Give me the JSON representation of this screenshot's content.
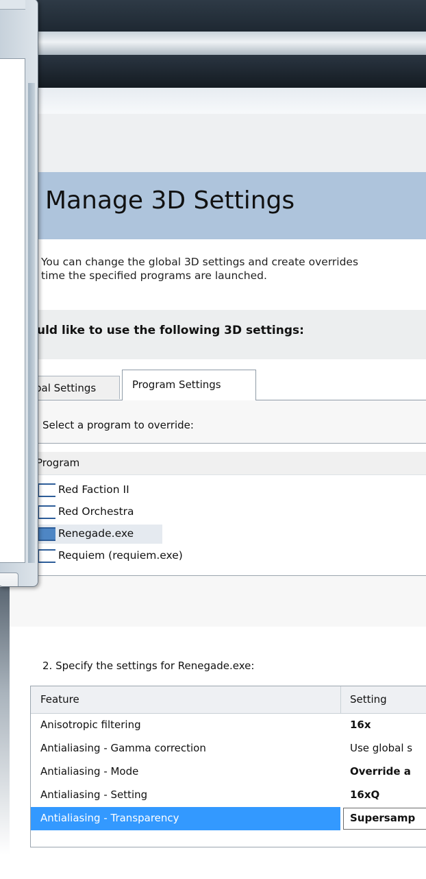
{
  "header": {
    "title": "Manage 3D Settings",
    "description_line1": "You can change the global 3D settings and create overrides",
    "description_line2": "time the specified programs are launched.",
    "subheader": "uld like to use the following 3D settings:"
  },
  "tabs": [
    {
      "label": "bal Settings",
      "active": false
    },
    {
      "label": "Program Settings",
      "active": true
    }
  ],
  "program_section": {
    "step_label": "Select a program to override:",
    "column_header": "Program",
    "programs": [
      {
        "label": "Red Faction II",
        "selected": false
      },
      {
        "label": "Red Orchestra",
        "selected": false
      },
      {
        "label": "Renegade.exe",
        "selected": true
      },
      {
        "label": "Requiem (requiem.exe)",
        "selected": false
      }
    ]
  },
  "settings_section": {
    "step_label": "2. Specify the settings for Renegade.exe:",
    "columns": [
      "Feature",
      "Setting"
    ],
    "rows": [
      {
        "feature": "Anisotropic filtering",
        "setting": "16x",
        "bold": true,
        "selected": false
      },
      {
        "feature": "Antialiasing - Gamma correction",
        "setting": "Use global s",
        "bold": false,
        "selected": false
      },
      {
        "feature": "Antialiasing - Mode",
        "setting": "Override a",
        "bold": true,
        "selected": false
      },
      {
        "feature": "Antialiasing - Setting",
        "setting": "16xQ",
        "bold": true,
        "selected": false
      },
      {
        "feature": "Antialiasing - Transparency",
        "setting": "Supersamp",
        "bold": true,
        "selected": true
      }
    ]
  },
  "colors": {
    "banner": "#aec4dc",
    "selection": "#3399ff",
    "checkbox_border": "#2d5d99"
  },
  "icons": {
    "program_checkbox": "checkbox-icon"
  }
}
